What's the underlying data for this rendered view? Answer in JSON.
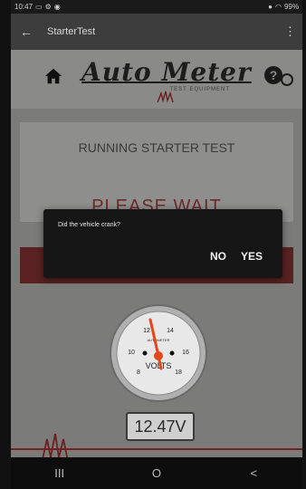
{
  "status": {
    "time": "10:47",
    "battery": "99%"
  },
  "appbar": {
    "title": "StarterTest"
  },
  "brand": {
    "logo_text": "Auto Meter",
    "sub_text": "TEST EQUIPMENT"
  },
  "card": {
    "running": "RUNNING STARTER TEST",
    "wait": "PLEASE WAIT"
  },
  "dialog": {
    "message": "Did the vehicle crank?",
    "no_label": "NO",
    "yes_label": "YES"
  },
  "gauge": {
    "units": "VOLTS",
    "ticks": [
      "8",
      "10",
      "12",
      "14",
      "16",
      "18"
    ],
    "brand": "AUTOMETER"
  },
  "voltage": {
    "reading": "12.47V"
  },
  "navbar": {
    "recent": "III",
    "home": "O",
    "back": "<"
  },
  "icons": {
    "back": "arrow-left-icon",
    "more": "more-vert-icon",
    "home": "home-icon",
    "help": "help-icon"
  }
}
